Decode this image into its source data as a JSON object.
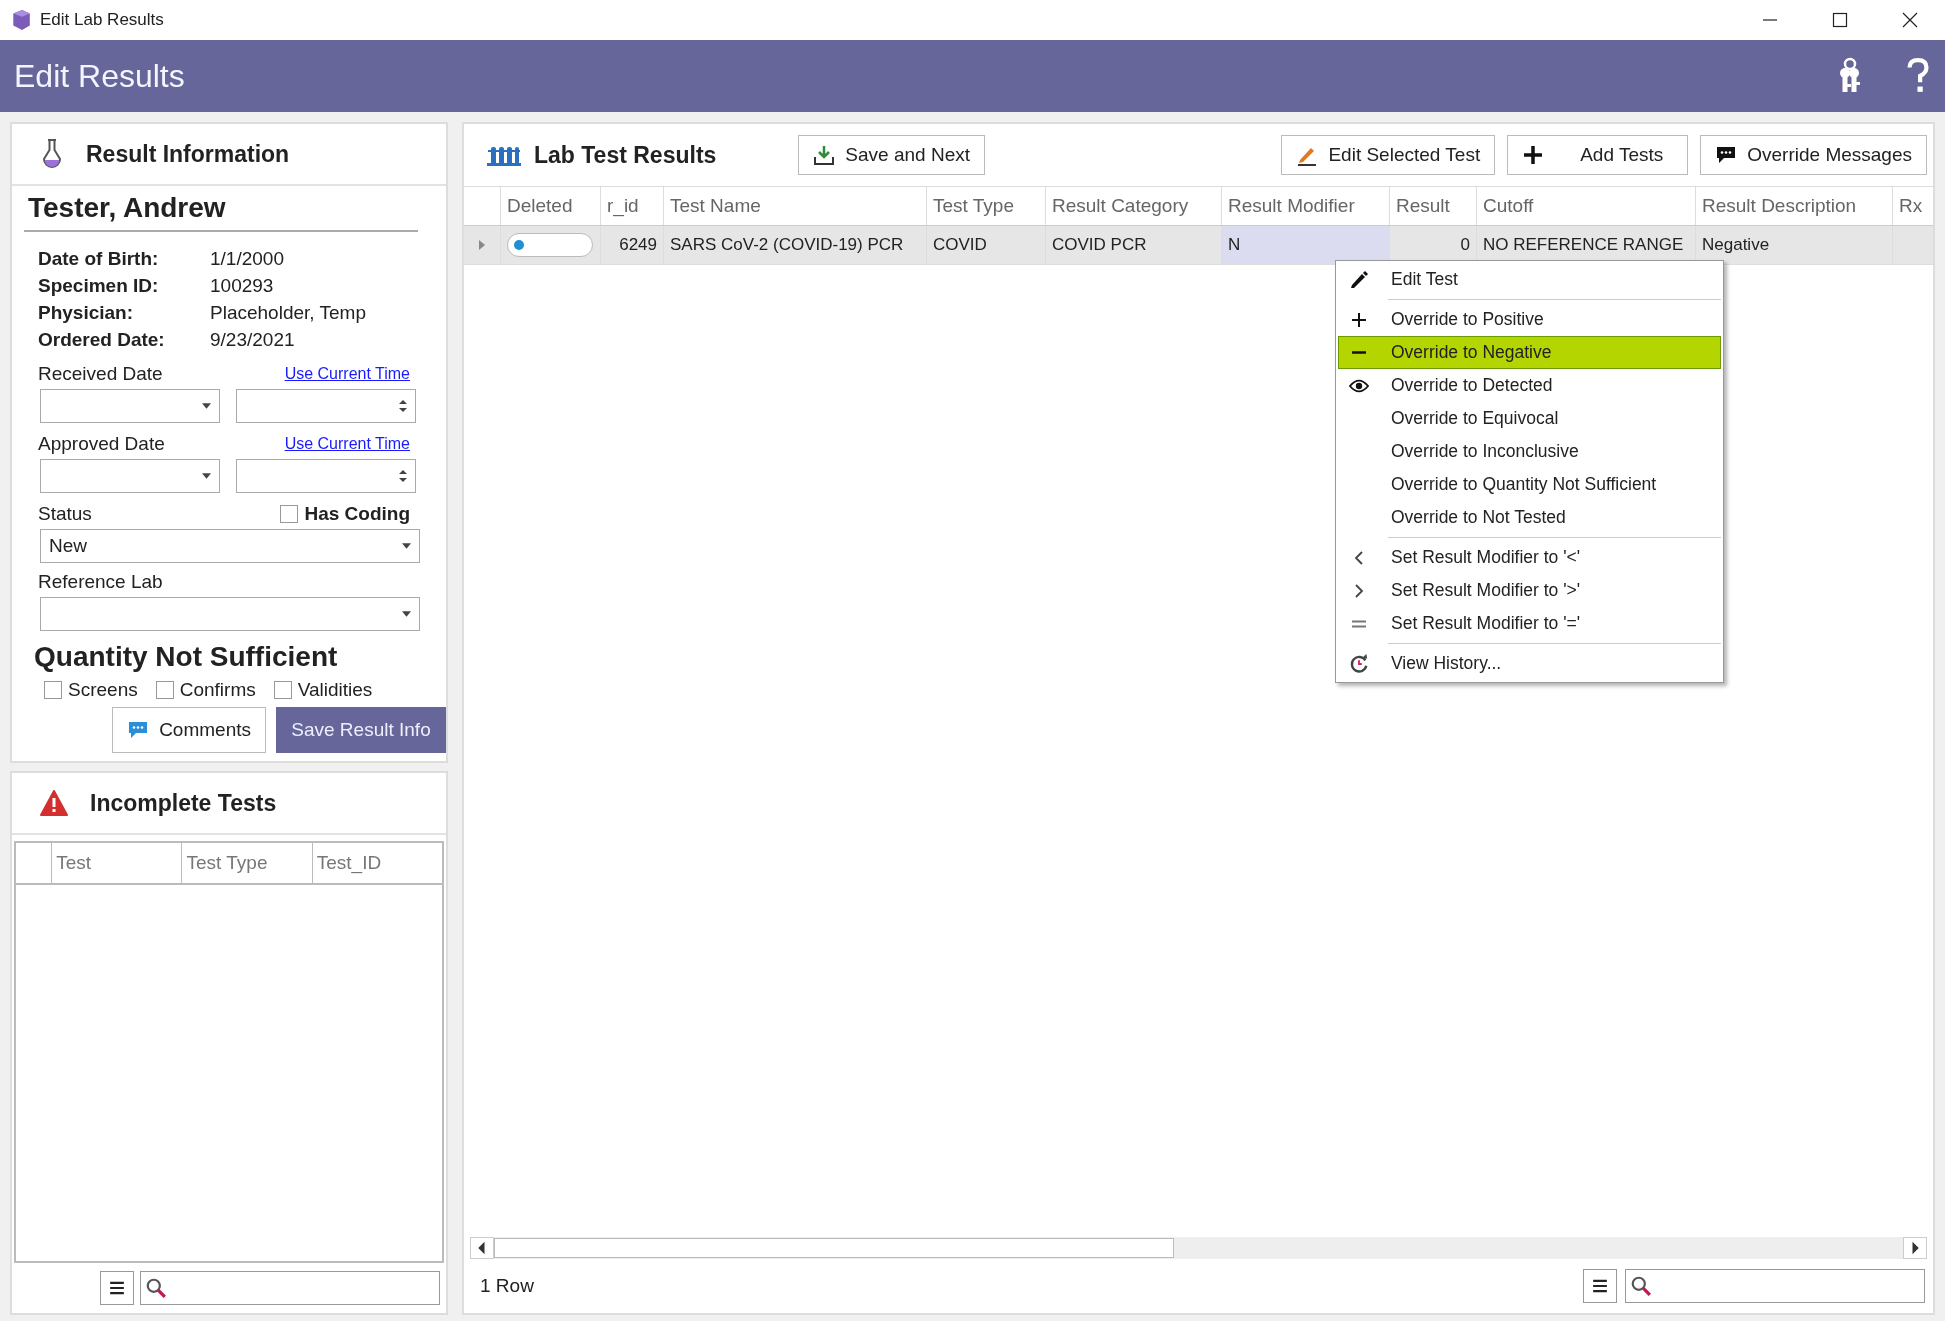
{
  "window": {
    "title": "Edit Lab Results"
  },
  "header": {
    "title": "Edit Results"
  },
  "result_info": {
    "title": "Result Information",
    "patient": "Tester, Andrew",
    "fields": [
      {
        "label": "Date of Birth:",
        "value": "1/1/2000"
      },
      {
        "label": "Specimen ID:",
        "value": "100293"
      },
      {
        "label": "Physician:",
        "value": "Placeholder, Temp"
      },
      {
        "label": "Ordered Date:",
        "value": "9/23/2021"
      }
    ],
    "date_fields": [
      {
        "label": "Received Date",
        "link": "Use Current Time"
      },
      {
        "label": "Approved Date",
        "link": "Use Current Time"
      }
    ],
    "status": {
      "label": "Status",
      "value": "New"
    },
    "has_coding": {
      "label": "Has Coding",
      "checked": false
    },
    "reference_lab": {
      "label": "Reference Lab"
    },
    "qns": {
      "title": "Quantity Not Sufficient",
      "options": [
        {
          "label": "Screens",
          "checked": false
        },
        {
          "label": "Confirms",
          "checked": false
        },
        {
          "label": "Validities",
          "checked": false
        }
      ]
    },
    "comments_button": "Comments",
    "save_button": "Save Result Info"
  },
  "incomplete_tests": {
    "title": "Incomplete Tests",
    "columns": [
      "Test",
      "Test Type",
      "Test_ID"
    ]
  },
  "lab_results": {
    "title": "Lab Test Results",
    "toolbar": [
      {
        "label": "Save and Next",
        "kind": "download"
      },
      {
        "label": "Edit Selected Test",
        "kind": "edit"
      },
      {
        "label": "Add Tests",
        "kind": "add"
      },
      {
        "label": "Override Messages",
        "kind": "message"
      }
    ],
    "columns": [
      "Deleted",
      "r_id",
      "Test Name",
      "Test Type",
      "Result Category",
      "Result Modifier",
      "Result",
      "Cutoff",
      "Result Description",
      "Rx"
    ],
    "rows": [
      {
        "selected": true,
        "deleted": false,
        "cells": [
          "",
          "6249",
          "SARS CoV-2 (COVID-19) PCR",
          "COVID",
          "COVID PCR",
          "N",
          "0",
          "NO REFERENCE RANGE",
          "Negative"
        ]
      }
    ],
    "row_count": "1 Row"
  },
  "context_menu": {
    "items": [
      {
        "kind": "item",
        "label": "Edit Test",
        "selected": false
      },
      {
        "kind": "separator"
      },
      {
        "kind": "item",
        "label": "Override to Positive",
        "selected": false
      },
      {
        "kind": "item",
        "label": "Override to Negative",
        "selected": true
      },
      {
        "kind": "item",
        "label": "Override to Detected",
        "selected": false
      },
      {
        "kind": "item",
        "label": "Override to Equivocal",
        "selected": false
      },
      {
        "kind": "item",
        "label": "Override to Inconclusive",
        "selected": false
      },
      {
        "kind": "item",
        "label": "Override to Quantity Not Sufficient",
        "selected": false
      },
      {
        "kind": "item",
        "label": "Override to Not Tested",
        "selected": false
      },
      {
        "kind": "separator"
      },
      {
        "kind": "item",
        "label": "Set Result Modifier to '<'",
        "selected": false
      },
      {
        "kind": "item",
        "label": "Set Result Modifier to '>'",
        "selected": false
      },
      {
        "kind": "item",
        "label": "Set Result Modifier to '='",
        "selected": false
      },
      {
        "kind": "separator"
      },
      {
        "kind": "item",
        "label": "View History...",
        "selected": false
      }
    ]
  }
}
